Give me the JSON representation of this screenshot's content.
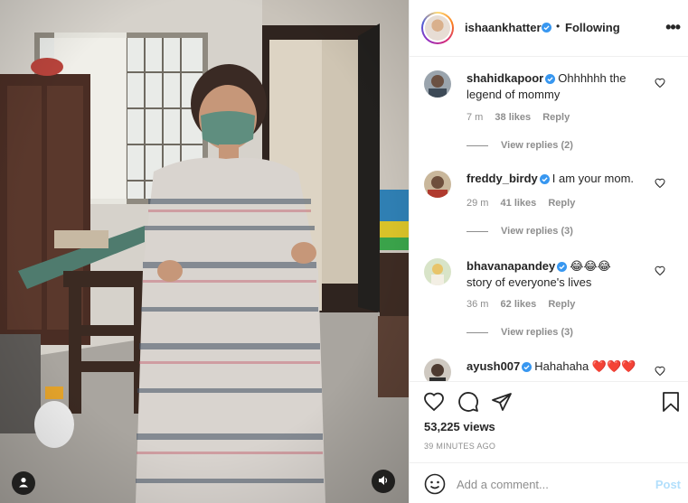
{
  "post": {
    "username": "ishaankhatter",
    "separator": "•",
    "follow_status": "Following",
    "more_label": "•••"
  },
  "comments": [
    {
      "author": "shahidkapoor",
      "verified": true,
      "text": "Ohhhhhh the legend of mommy",
      "time": "7 m",
      "likes": "38 likes",
      "reply": "Reply",
      "view_replies": "View replies (2)"
    },
    {
      "author": "freddy_birdy",
      "verified": true,
      "text": "I am your mom.",
      "time": "29 m",
      "likes": "41 likes",
      "reply": "Reply",
      "view_replies": "View replies (3)"
    },
    {
      "author": "bhavanapandey",
      "verified": true,
      "text": "😂😂😂",
      "text2": "story of everyone's lives",
      "time": "36 m",
      "likes": "62 likes",
      "reply": "Reply",
      "view_replies": "View replies (3)"
    },
    {
      "author": "ayush007",
      "verified": true,
      "text": "Hahahaha ❤️❤️❤️"
    }
  ],
  "actions": {
    "views": "53,225 views",
    "time_ago": "39 MINUTES AGO"
  },
  "composer": {
    "placeholder": "Add a comment...",
    "post_label": "Post"
  },
  "icons": {
    "like": "heart-icon",
    "comment": "comment-bubble-icon",
    "share": "paper-plane-icon",
    "save": "bookmark-icon",
    "emoji": "smiley-icon",
    "more": "ellipsis-icon",
    "verified": "verified-badge-icon",
    "media_user": "user-icon",
    "media_audio": "speaker-icon"
  },
  "colors": {
    "verified_blue": "#3897f0",
    "post_disabled": "#b2dffc",
    "secondary_text": "#8e8e8e"
  }
}
